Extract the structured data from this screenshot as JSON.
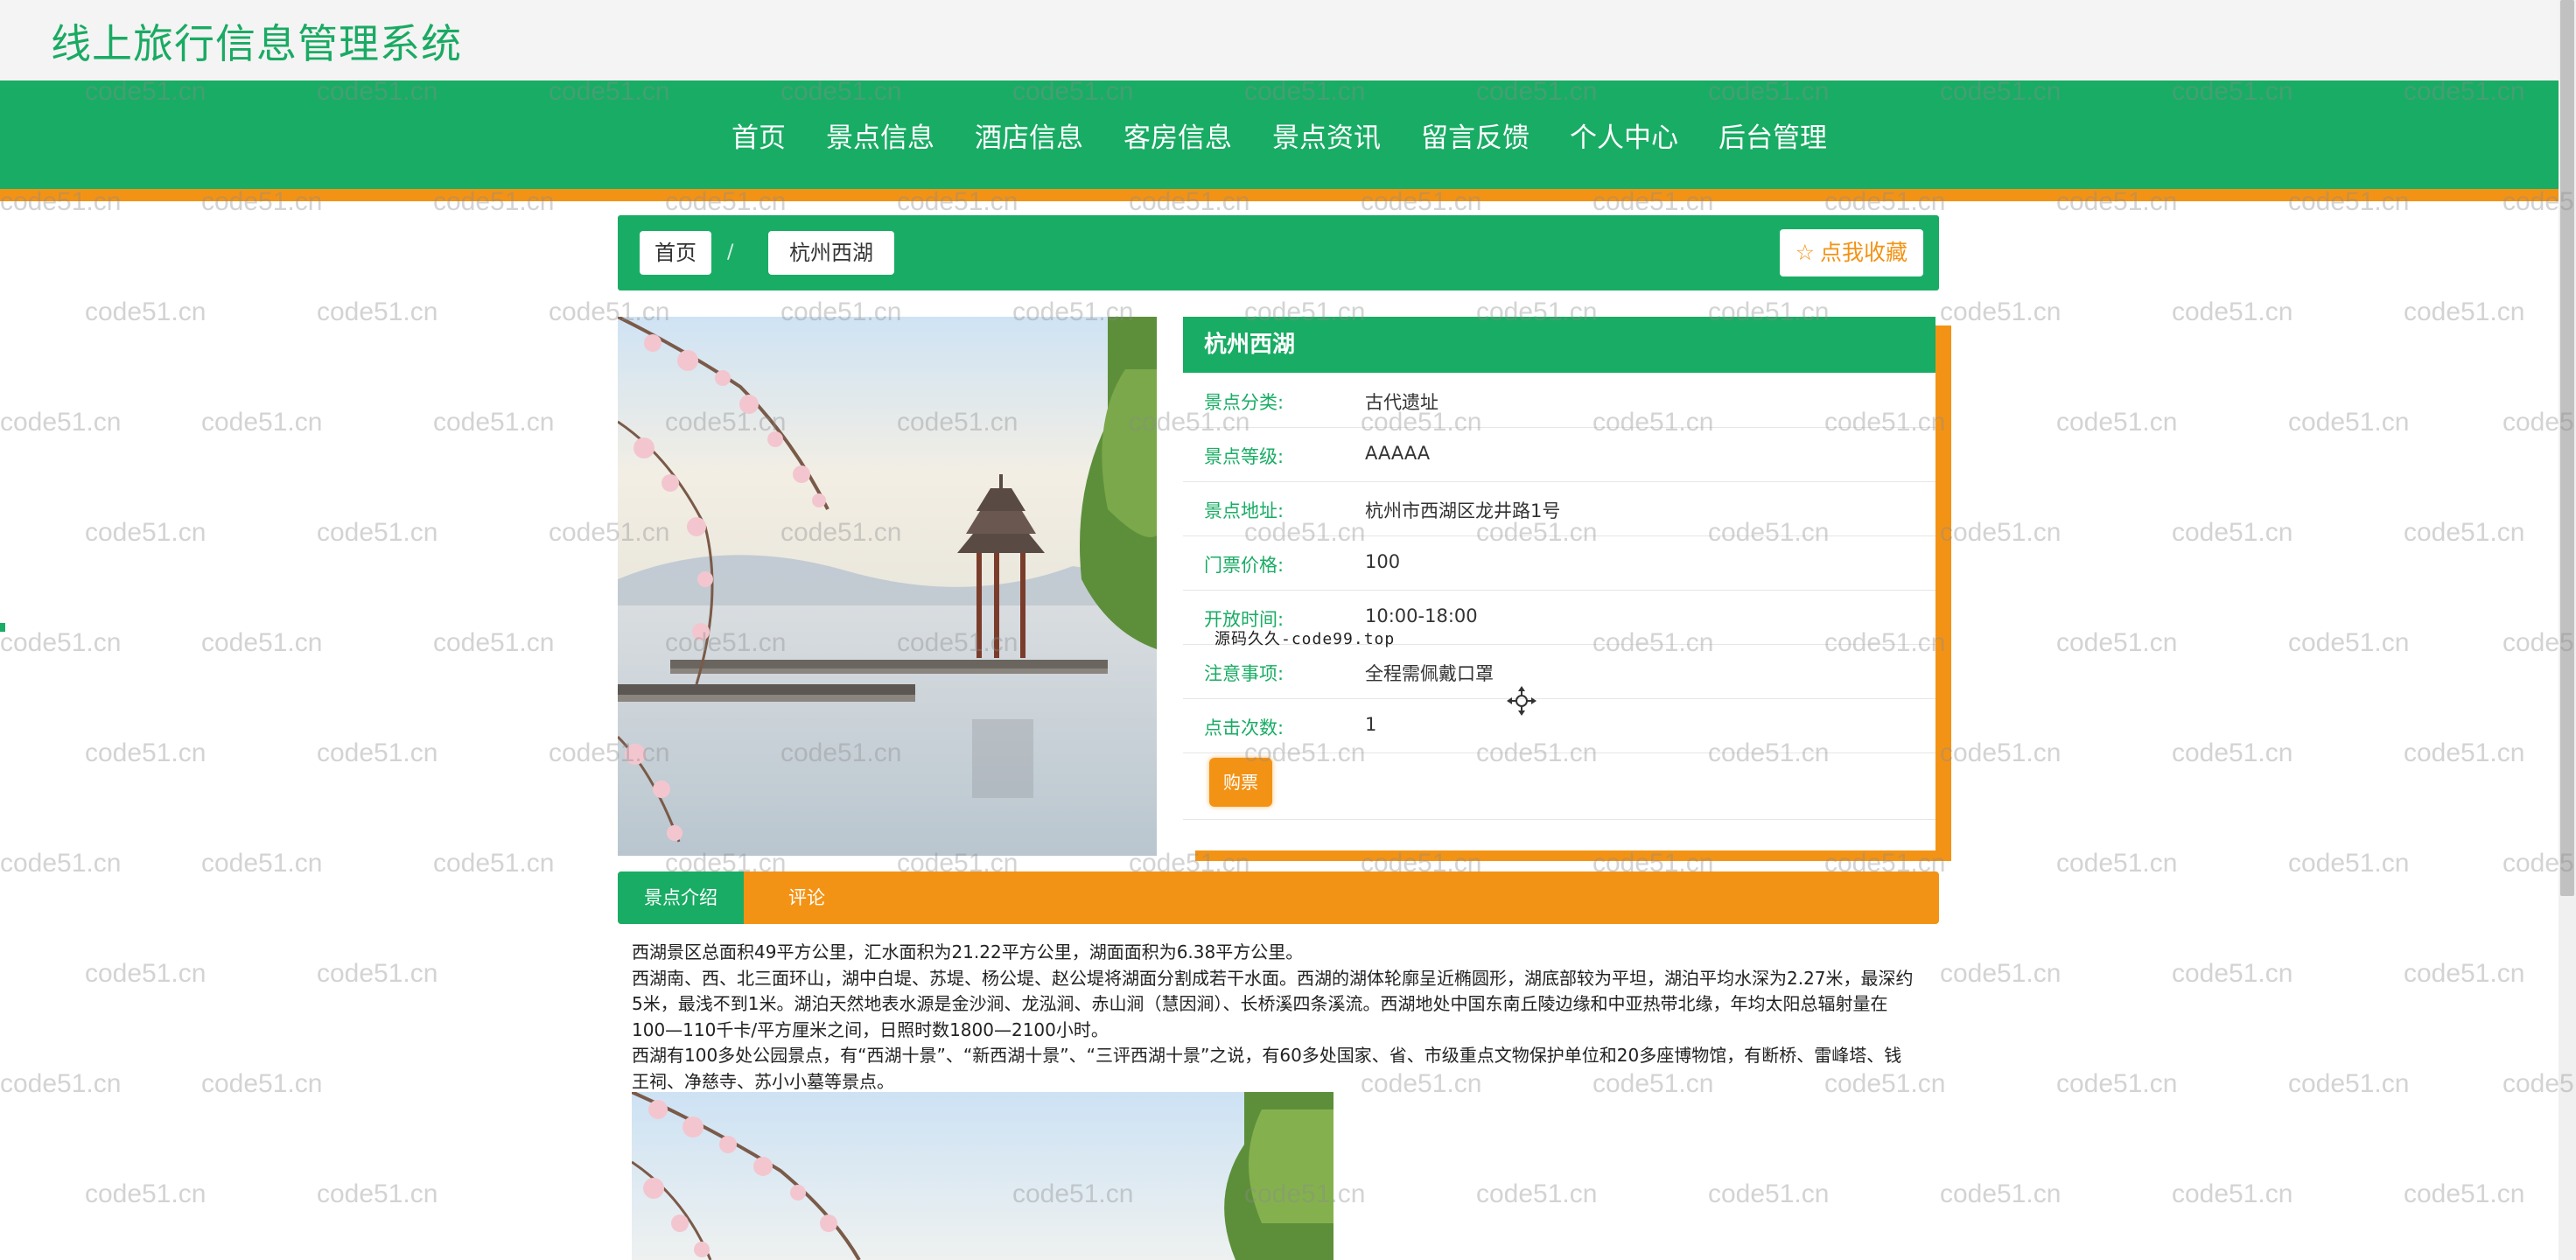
{
  "site": {
    "title": "线上旅行信息管理系统"
  },
  "nav": {
    "items": [
      "首页",
      "景点信息",
      "酒店信息",
      "客房信息",
      "景点资讯",
      "留言反馈",
      "个人中心",
      "后台管理"
    ]
  },
  "breadcrumb": {
    "home": "首页",
    "separator": "/",
    "current": "杭州西湖"
  },
  "favorite": {
    "icon": "star-outline-icon",
    "label": "点我收藏"
  },
  "detail": {
    "title": "杭州西湖",
    "rows": [
      {
        "label": "景点分类:",
        "value": "古代遗址"
      },
      {
        "label": "景点等级:",
        "value": "AAAAA"
      },
      {
        "label": "景点地址:",
        "value": "杭州市西湖区龙井路1号"
      },
      {
        "label": "门票价格:",
        "value": "100"
      },
      {
        "label": "开放时间:",
        "value": "10:00-18:00"
      },
      {
        "label": "注意事项:",
        "value": "全程需佩戴口罩"
      },
      {
        "label": "点击次数:",
        "value": "1"
      }
    ],
    "buy_label": "购票",
    "overlay_text": "源码久久-code99.top"
  },
  "tabs": {
    "intro": "景点介绍",
    "review": "评论"
  },
  "article": {
    "paragraphs": [
      "西湖景区总面积49平方公里，汇水面积为21.22平方公里，湖面面积为6.38平方公里。",
      "西湖南、西、北三面环山，湖中白堤、苏堤、杨公堤、赵公堤将湖面分割成若干水面。西湖的湖体轮廓呈近椭圆形，湖底部较为平坦，湖泊平均水深为2.27米，最深约5米，最浅不到1米。湖泊天然地表水源是金沙涧、龙泓涧、赤山涧（慧因涧）、长桥溪四条溪流。西湖地处中国东南丘陵边缘和中亚热带北缘，年均太阳总辐射量在100—110千卡/平方厘米之间，日照时数1800—2100小时。",
      "西湖有100多处公园景点，有“西湖十景”、“新西湖十景”、“三评西湖十景”之说，有60多处国家、省、市级重点文物保护单位和20多座博物馆，有断桥、雷峰塔、钱王祠、净慈寺、苏小小墓等景点。"
    ]
  },
  "watermark": {
    "text": "code51.cn"
  },
  "colors": {
    "brand_green": "#19ac64",
    "accent_orange": "#f39315"
  }
}
